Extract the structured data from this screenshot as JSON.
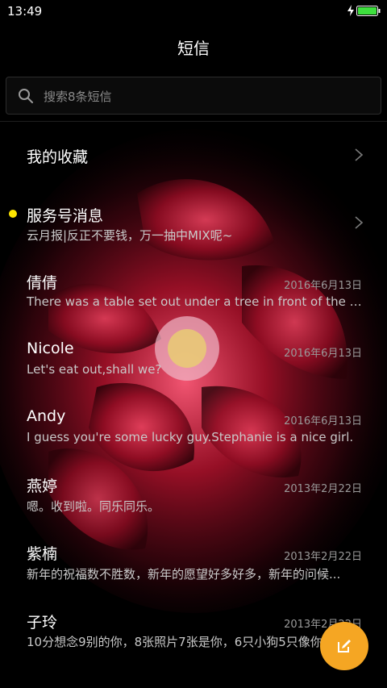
{
  "status": {
    "time": "13:49"
  },
  "header": {
    "title": "短信"
  },
  "search": {
    "placeholder": "搜索8条短信"
  },
  "colors": {
    "fab": "#f5a623",
    "unread_dot": "#ffe600",
    "battery": "#3ee03e"
  },
  "conversations": [
    {
      "title": "我的收藏",
      "subtitle": "",
      "date": "",
      "chevron": true,
      "unread": false
    },
    {
      "title": "服务号消息",
      "subtitle": "云月报|反正不要钱，万一抽中MIX呢~",
      "date": "",
      "chevron": true,
      "unread": true
    },
    {
      "title": "倩倩",
      "subtitle": "There was a table set out under a tree in front of the ho...",
      "date": "2016年6月13日",
      "chevron": false,
      "unread": false
    },
    {
      "title": "Nicole",
      "subtitle": "Let's eat out,shall we?",
      "date": "2016年6月13日",
      "chevron": false,
      "unread": false
    },
    {
      "title": "Andy",
      "subtitle": "I guess you're some lucky guy.Stephanie is a nice girl.",
      "date": "2016年6月13日",
      "chevron": false,
      "unread": false
    },
    {
      "title": "燕婷",
      "subtitle": "嗯。收到啦。同乐同乐。",
      "date": "2013年2月22日",
      "chevron": false,
      "unread": false
    },
    {
      "title": "紫楠",
      "subtitle": "新年的祝福数不胜数，新年的愿望好多好多，新年的问候...",
      "date": "2013年2月22日",
      "chevron": false,
      "unread": false
    },
    {
      "title": "子玲",
      "subtitle": "10分想念9别的你，8张照片7张是你，6只小狗5只像你...",
      "date": "2013年2月22日",
      "chevron": false,
      "unread": false
    }
  ],
  "icons": {
    "search": "search-icon",
    "chevron": "chevron-right-icon",
    "compose": "compose-icon",
    "battery": "battery-icon",
    "charging": "charging-bolt-icon"
  }
}
